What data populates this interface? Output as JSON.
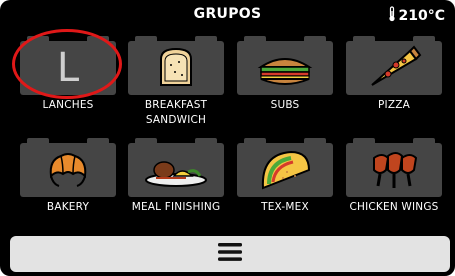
{
  "header": {
    "title": "GRUPOS",
    "temperature": "210°C",
    "thermometer_icon": "thermometer-icon"
  },
  "tiles": [
    {
      "label": "LANCHES",
      "icon": "letter-l",
      "glyph": "L"
    },
    {
      "label": "BREAKFAST SANDWICH",
      "icon": "sandwich-icon"
    },
    {
      "label": "SUBS",
      "icon": "sub-sandwich-icon"
    },
    {
      "label": "PIZZA",
      "icon": "pizza-slice-icon"
    },
    {
      "label": "BAKERY",
      "icon": "croissant-icon"
    },
    {
      "label": "MEAL FINISHING",
      "icon": "plated-meal-icon"
    },
    {
      "label": "TEX-MEX",
      "icon": "taco-icon"
    },
    {
      "label": "CHICKEN WINGS",
      "icon": "chicken-wings-icon"
    }
  ],
  "footer": {
    "menu_icon": "hamburger-menu-icon"
  },
  "colors": {
    "background": "#000000",
    "tile": "#454545",
    "highlight_ring": "#e01818",
    "menu_bar": "#e3e3e3"
  }
}
